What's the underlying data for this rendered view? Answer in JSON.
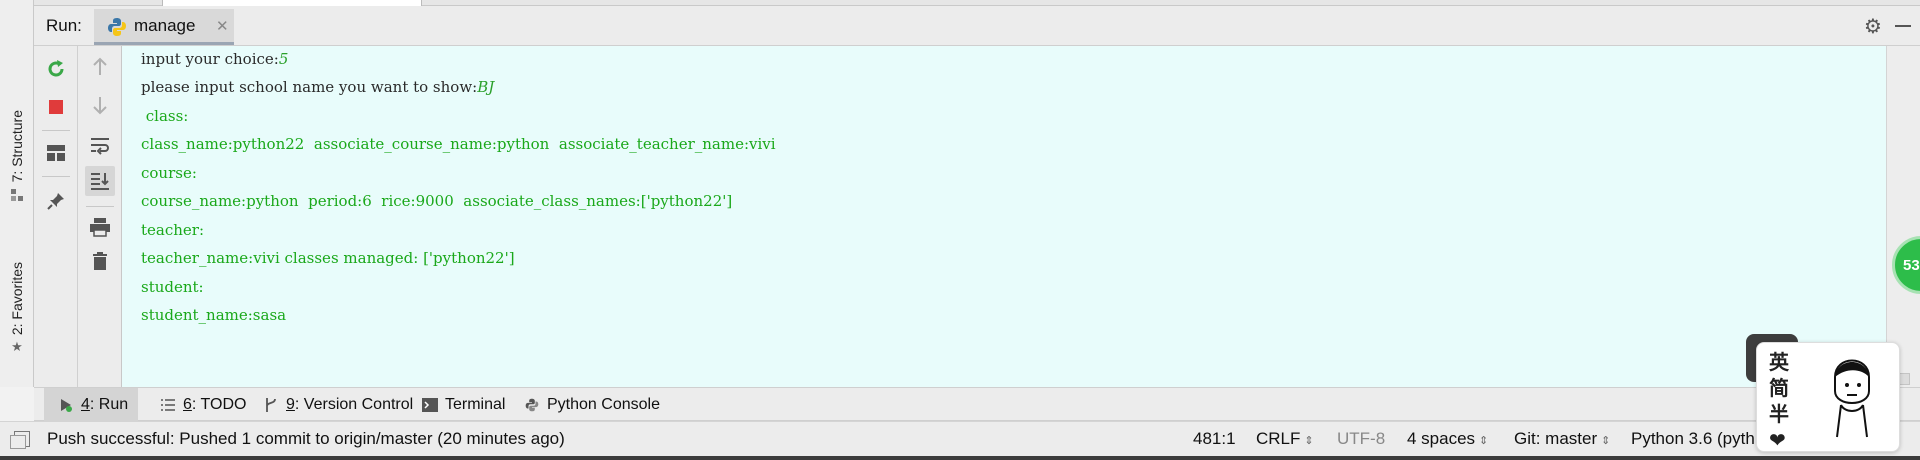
{
  "left_tabs": [
    {
      "label": "7: Structure"
    },
    {
      "label": "2: Favorites"
    }
  ],
  "run_header": {
    "label": "Run:",
    "tab_name": "manage"
  },
  "toolbar_left": [
    {
      "name": "rerun-icon"
    },
    {
      "name": "stop-icon"
    },
    {
      "name": "layout-icon"
    },
    {
      "name": "pin-icon"
    }
  ],
  "toolbar_right": [
    {
      "name": "up-arrow-icon"
    },
    {
      "name": "down-arrow-icon"
    },
    {
      "name": "soft-wrap-icon"
    },
    {
      "name": "scroll-to-end-icon"
    },
    {
      "name": "print-icon"
    },
    {
      "name": "trash-icon"
    }
  ],
  "console": {
    "prompt1": "input your choice:",
    "input1": "5",
    "prompt2": "please input school name you want to show:",
    "input2": "BJ",
    "output": [
      " class:",
      "class_name:python22  associate_course_name:python  associate_teacher_name:vivi",
      "course:",
      "course_name:python  period:6  rice:9000  associate_class_names:['python22']",
      "teacher:",
      "teacher_name:vivi classes managed: ['python22']",
      "student:",
      "student_name:sasa"
    ]
  },
  "badge": "53",
  "tool_tabs": [
    {
      "num": "4",
      "label": ": Run",
      "icon": "run-icon"
    },
    {
      "num": "6",
      "label": ": TODO",
      "icon": "todo-icon"
    },
    {
      "num": "9",
      "label": ": Version Control",
      "icon": "vcs-icon"
    },
    {
      "num": "",
      "label": "Terminal",
      "icon": "terminal-icon"
    },
    {
      "num": "",
      "label": "Python Console",
      "icon": "python-console-icon"
    }
  ],
  "status": {
    "message": "Push successful: Pushed 1 commit to origin/master (20 minutes ago)",
    "position": "481:1",
    "line_sep": "CRLF",
    "encoding": "UTF-8",
    "indent": "4 spaces",
    "git": "Git: master",
    "interpreter": "Python 3.6 (pyth"
  },
  "sticker": {
    "text": "英\n简\n半\n❤"
  },
  "colors": {
    "console_bg": "#e8fcfb",
    "output_green": "#1aa81a",
    "rerun_green": "#3aa848",
    "stop_red": "#e03b3b"
  }
}
